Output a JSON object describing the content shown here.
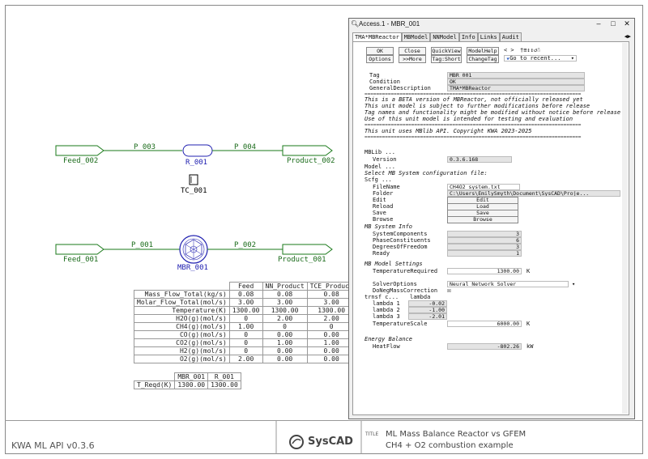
{
  "footer": {
    "version": "KWA ML API v0.3.6",
    "logo_text": "SysCAD",
    "title_label": "TITLE",
    "title_line1": "ML Mass Balance Reactor vs GFEM",
    "title_line2": "CH4 + O2 combustion example"
  },
  "flowsheet": {
    "feed_top": "Feed_002",
    "pipe_p003": "P_003",
    "reactor_top": "R_001",
    "pipe_p004": "P_004",
    "product_top": "Product_002",
    "controller": "TC_001",
    "feed_bottom": "Feed_001",
    "pipe_p001": "P_001",
    "reactor_bottom": "MBR_001",
    "pipe_p002": "P_002",
    "product_bottom": "Product_001"
  },
  "stream_table": {
    "headers": [
      "",
      "Feed",
      "NN_Product",
      "TCE_Product"
    ],
    "rows": [
      [
        "Mass_Flow_Total(kg/s)",
        "0.08",
        "0.08",
        "0.08"
      ],
      [
        "Molar_Flow_Total(mol/s)",
        "3.00",
        "3.00",
        "3.00"
      ],
      [
        "Temperature(K)",
        "1300.00",
        "1300.00",
        "1300.00"
      ],
      [
        "H2O(g)(mol/s)",
        "0",
        "2.00",
        "2.00"
      ],
      [
        "CH4(g)(mol/s)",
        "1.00",
        "0",
        "0"
      ],
      [
        "CO(g)(mol/s)",
        "0",
        "0.00",
        "0.00"
      ],
      [
        "CO2(g)(mol/s)",
        "0",
        "1.00",
        "1.00"
      ],
      [
        "H2(g)(mol/s)",
        "0",
        "0.00",
        "0.00"
      ],
      [
        "O2(g)(mol/s)",
        "2.00",
        "0.00",
        "0.00"
      ]
    ]
  },
  "treqd_table": {
    "headers": [
      "",
      "MBR_001",
      "R_001"
    ],
    "rows": [
      [
        "T_Reqd(K)",
        "1300.00",
        "1300.00"
      ]
    ]
  },
  "window": {
    "title": "Access.1 - MBR_001",
    "tabs": [
      "TMA*MBReactor",
      "MBModel",
      "NNModel",
      "Info",
      "Links",
      "Audit"
    ],
    "buttons": {
      "ok": "OK",
      "close": "Close",
      "quickview": "QuickView",
      "modelhelp": "ModelHelp",
      "options": "Options",
      "more": ">>More",
      "tagshort": "Tag:Short",
      "changetag": "ChangeTag"
    },
    "nav_icons": "< > ",
    "goto_recent": "Go to recent...",
    "tag_label": "Tag",
    "tag_value": "MBR_001",
    "condition_label": "Condition",
    "condition_value": "OK",
    "gendesc_label": "GeneralDescription",
    "gendesc_value": "TMA*MBReactor",
    "separator": "==========================================================================",
    "beta1": "This is a BETA version of MBReactor, not officially released yet",
    "beta2": "This unit model is subject to further modifications before release",
    "beta3": "Tag names and functionality might be modified without notice before release",
    "beta4": "Use of this unit model is intended for testing and evaluation",
    "api_line": "This unit uses MBlib API. Copyright KWA 2023-2025",
    "mblib": "MBLib ...",
    "version_label": "Version",
    "version_value": "0.3.6.168",
    "model": "Model ...",
    "select_cfg": "Select MB System configuration file:",
    "scfg": "Scfg ...",
    "filename_label": "FileName",
    "filename_value": "CH4O2_system.txt",
    "folder_label": "Folder",
    "folder_value": "C:\\Users\\EmilySmyth\\Document\\SysCAD\\Proje...",
    "edit_label": "Edit",
    "edit_btn": "Edit",
    "reload_label": "Reload",
    "reload_btn": "Load",
    "save_label": "Save",
    "save_btn": "Save",
    "browse_label": "Browse",
    "browse_btn": "Browse",
    "mbinfo": "MB System Info",
    "syscomp_label": "SystemComponents",
    "syscomp_value": "3",
    "phasecon_label": "PhaseConstituents",
    "phasecon_value": "6",
    "dof_label": "DegreesOfFreedom",
    "dof_value": "3",
    "ready_label": "Ready",
    "ready_value": "1",
    "mbsettings": "MB Model Settings",
    "treq_label": "TemperatureRequired",
    "treq_value": "1300.00",
    "treq_unit": "K",
    "solver_label": "SolverOptions",
    "solver_value": "Neural Network Solver",
    "doneg_label": "DoNegMassCorrection",
    "doneg_check": "☒",
    "trnsf": "trnsf c...",
    "lambda_hdr": "lambda",
    "l1_label": "lambda 1",
    "l1_value": "-0.02",
    "l2_label": "lambda 2",
    "l2_value": "-1.00",
    "l3_label": "lambda 3",
    "l3_value": "-2.01",
    "tscale_label": "TemperatureScale",
    "tscale_value": "6000.00",
    "tscale_unit": "K",
    "energy": "Energy Balance",
    "heatflow_label": "HeatFlow",
    "heatflow_value": "-802.26",
    "heatflow_unit": "kW"
  }
}
